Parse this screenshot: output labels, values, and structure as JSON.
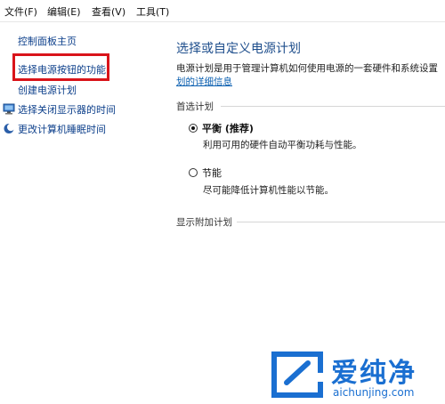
{
  "menubar": {
    "items": [
      {
        "label": "文件(F)"
      },
      {
        "label": "编辑(E)"
      },
      {
        "label": "查看(V)"
      },
      {
        "label": "工具(T)"
      }
    ]
  },
  "sidebar": {
    "items": [
      {
        "label": "控制面板主页"
      },
      {
        "label": "选择电源按钮的功能",
        "highlighted": true
      },
      {
        "label": "创建电源计划"
      },
      {
        "label": "选择关闭显示器的时间",
        "icon": "monitor-icon"
      },
      {
        "label": "更改计算机睡眠时间",
        "icon": "moon-icon"
      }
    ]
  },
  "main": {
    "title": "选择或自定义电源计划",
    "description": "电源计划是用于管理计算机如何使用电源的一套硬件和系统设置",
    "details_link": "划的详细信息",
    "preferred_label": "首选计划",
    "plans": [
      {
        "name": "平衡 (推荐)",
        "description": "利用可用的硬件自动平衡功耗与性能。",
        "selected": true
      },
      {
        "name": "节能",
        "description": "尽可能降低计算机性能以节能。",
        "selected": false
      }
    ],
    "additional_label": "显示附加计划"
  },
  "watermark": {
    "brand": "爱纯净",
    "site": "aichunjing.com"
  },
  "colors": {
    "link": "#0b3e8a",
    "title": "#1e4e8c",
    "highlight": "#d9141a",
    "watermark": "#1a6fd1"
  }
}
